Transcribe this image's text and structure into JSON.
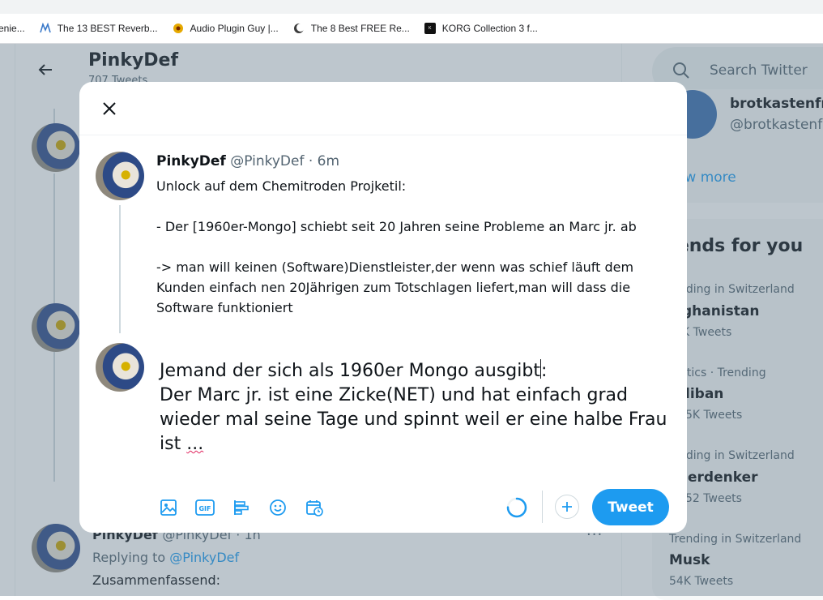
{
  "browser": {
    "bookmarks": [
      {
        "label": "enie...",
        "icon": "none",
        "color": "#ffffff"
      },
      {
        "label": "The 13 BEST Reverb...",
        "icon": "m-logo-icon",
        "color": "#3a79c9"
      },
      {
        "label": "Audio Plugin Guy |...",
        "icon": "apg-logo-icon",
        "color": "#e6a900"
      },
      {
        "label": "The 8 Best FREE Re...",
        "icon": "moon-logo-icon",
        "color": "#3c3c3c"
      },
      {
        "label": "KORG Collection 3 f...",
        "icon": "korg-logo-icon",
        "color": "#111111"
      }
    ]
  },
  "profile": {
    "name": "PinkyDef",
    "tweet_count": "707 Tweets"
  },
  "background_tweet": {
    "name": "PinkyDef",
    "handle": "@PinkyDef · 1h",
    "replying_prefix": "Replying to",
    "replying_to": "@PinkyDef",
    "body": "Zusammenfassend:",
    "more": "···"
  },
  "sidebar": {
    "search_placeholder": "Search Twitter",
    "suggest_name": "brotkastenfr",
    "suggest_handle": "@brotkastenfr",
    "show_more": "ow more",
    "trends_title": "rends for you",
    "trends": [
      {
        "context": "nding in Switzerland",
        "name": "ghanistan",
        "count": "K Tweets"
      },
      {
        "context": "itics · Trending",
        "name": "liban",
        "count": "5K Tweets"
      },
      {
        "context": "nding in Switzerland",
        "name": "erdenker",
        "count": "52 Tweets"
      },
      {
        "context": "Trending in Switzerland",
        "name": "Musk",
        "count": "54K Tweets"
      }
    ]
  },
  "modal": {
    "quoted": {
      "name": "PinkyDef",
      "handle": "@PinkyDef",
      "dot": "·",
      "time": "6m",
      "line1": "Unlock auf dem Chemitroden Projketil:",
      "line2": "- Der [1960er-Mongo] schiebt seit 20 Jahren seine Probleme an Marc jr. ab",
      "line3": "-> man will keinen (Software)Dienstleister,der wenn was schief läuft dem Kunden einfach nen 20Jährigen zum Totschlagen liefert,man will dass die Software funktioniert"
    },
    "compose": {
      "line1_before": "Jemand der sich als 1960er Mongo ausgibt",
      "line1_after": ":",
      "line2_before": "Der Marc jr. ist eine Zicke(NET) und hat einfach grad wieder mal seine Tage und spinnt weil er eine halbe Frau ist ",
      "line2_spell": "..."
    },
    "tweet_button": "Tweet",
    "gif_label": "GIF",
    "progress": 0.75
  },
  "colors": {
    "accent": "#1d9bf0",
    "overlay": "rgba(91,112,131,0.40)"
  }
}
